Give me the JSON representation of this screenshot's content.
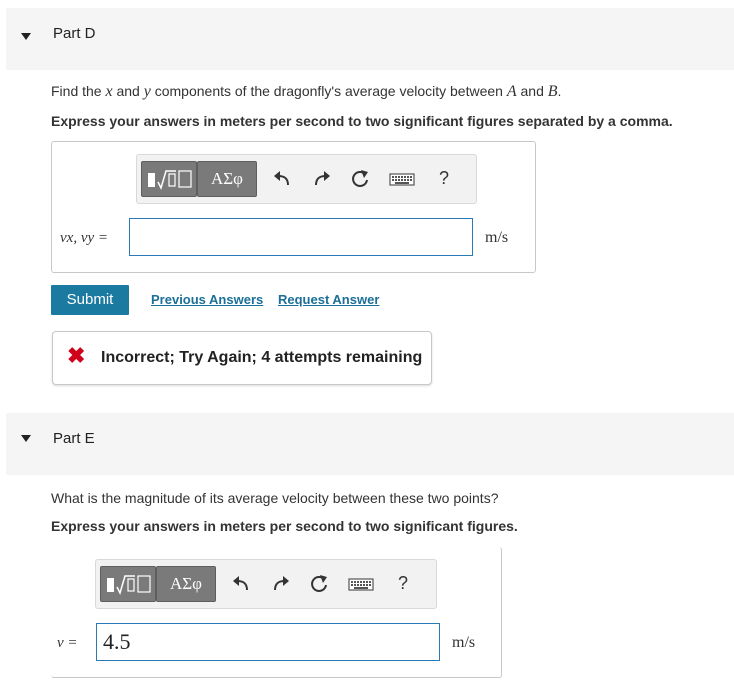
{
  "part_d": {
    "title": "Part D",
    "question_prefix": "Find the ",
    "q_var_x": "x",
    "q_and1": " and ",
    "q_var_y": "y",
    "q_middle": " components of the dragonfly's average velocity between ",
    "q_var_A": "A",
    "q_and2": " and ",
    "q_var_B": "B",
    "q_end": ".",
    "instruction": "Express your answers in meters per second to two significant figures separated by a comma.",
    "toolbar": {
      "greek_label": "ΑΣφ",
      "help_label": "?"
    },
    "variable_label": "vx, vy =",
    "input_value": "",
    "unit": "m/s",
    "submit_label": "Submit",
    "previous_answers_label": "Previous Answers",
    "request_answer_label": "Request Answer",
    "feedback": {
      "icon": "✖",
      "text": "Incorrect; Try Again; 4 attempts remaining",
      "color": "#d0021b"
    }
  },
  "part_e": {
    "title": "Part E",
    "question": "What is the magnitude of its average velocity between these two points?",
    "instruction": "Express your answers in meters per second to two significant figures.",
    "toolbar": {
      "greek_label": "ΑΣφ",
      "help_label": "?"
    },
    "variable_label": "v =",
    "input_value": "4.5",
    "unit": "m/s"
  }
}
